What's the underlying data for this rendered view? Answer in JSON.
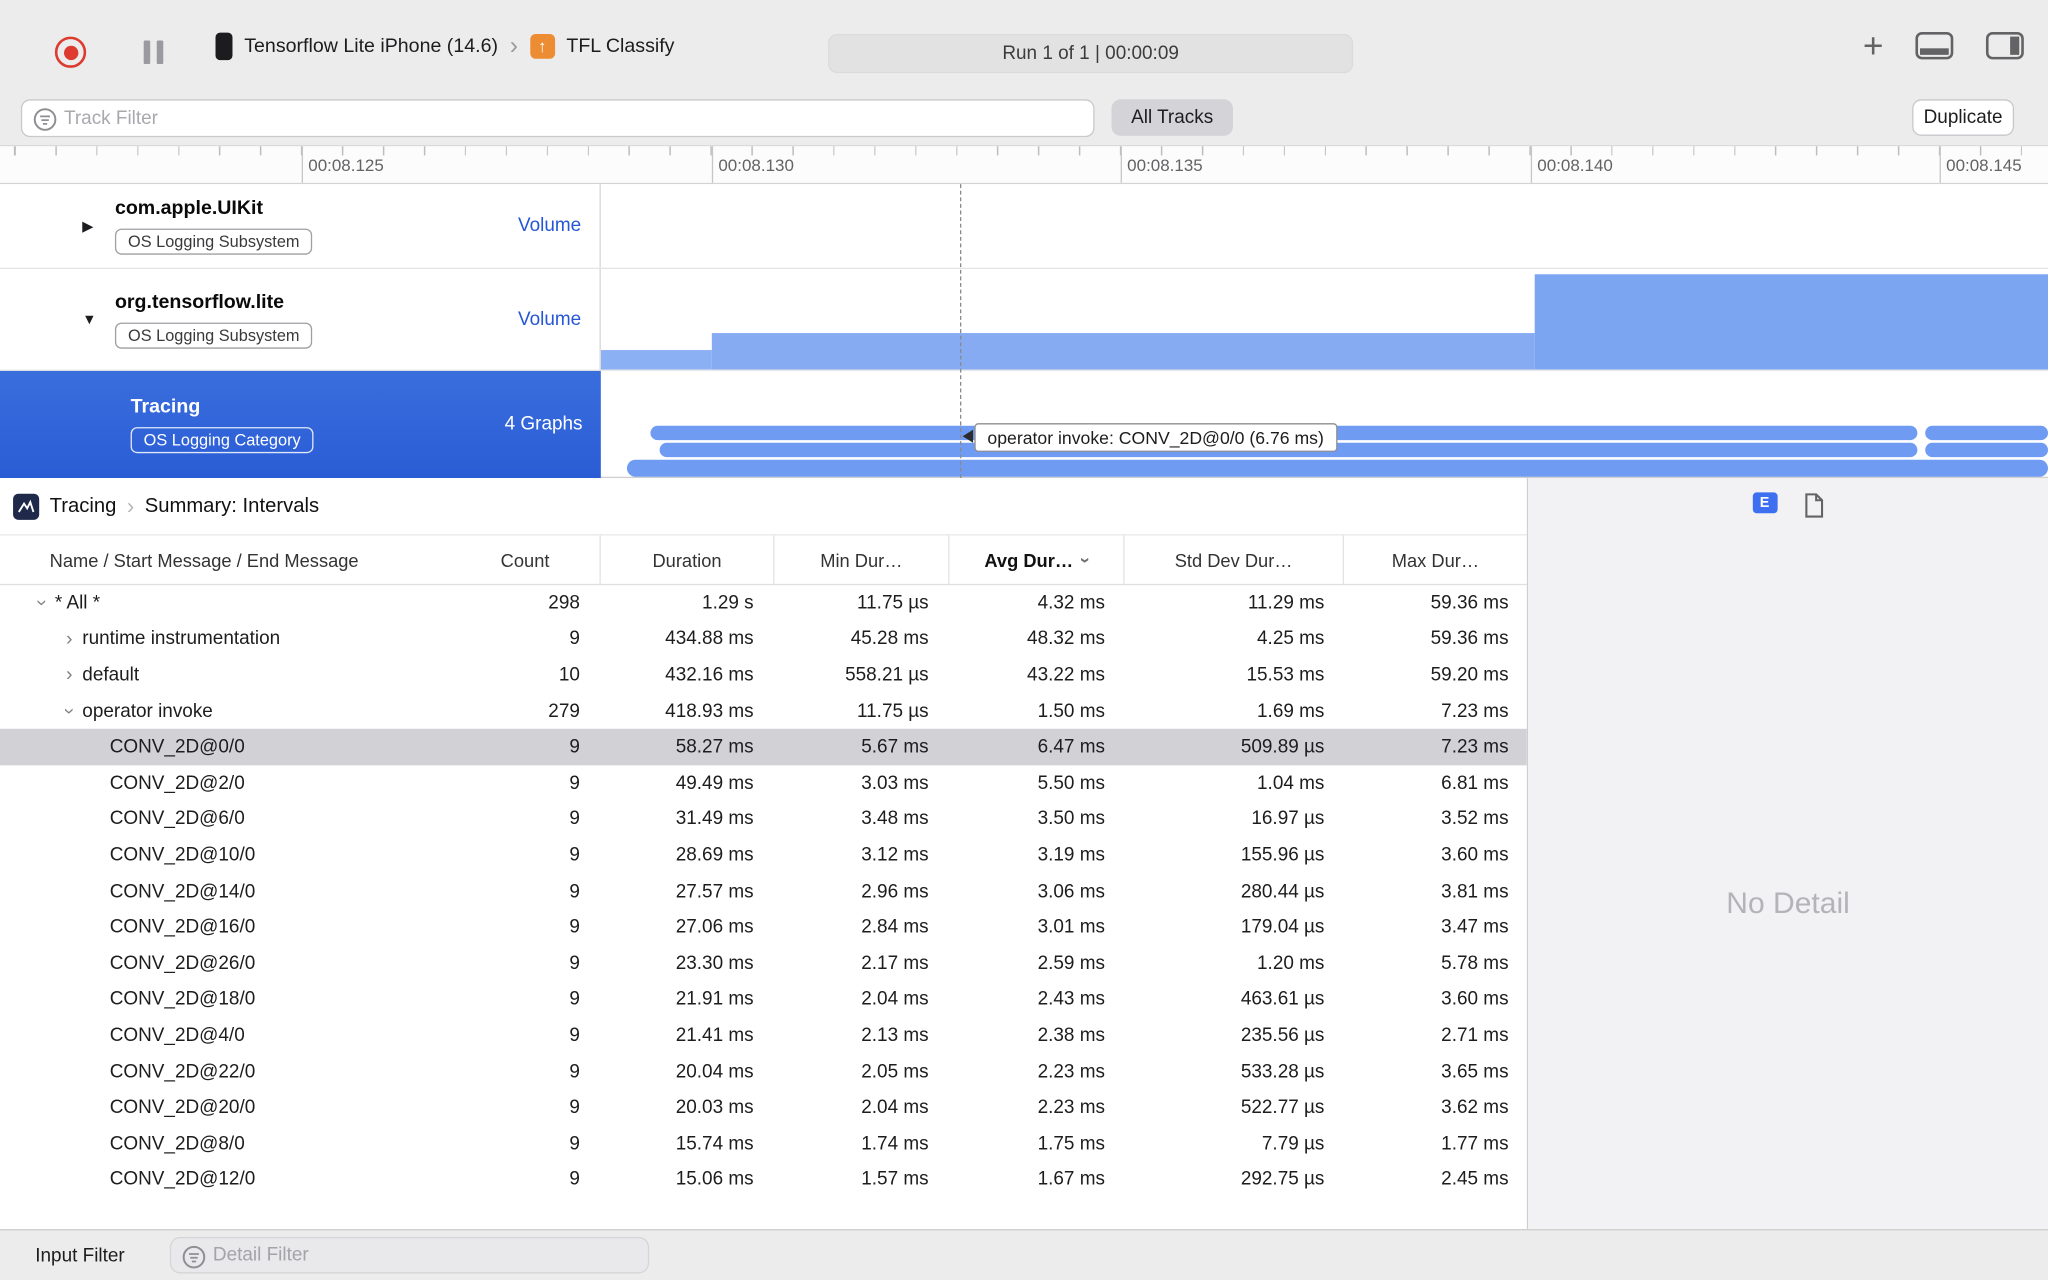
{
  "toolbar": {
    "device_label": "Tensorflow Lite iPhone (14.6)",
    "app_label": "TFL Classify",
    "run_status": "Run 1 of 1  |  00:00:09"
  },
  "filter_bar": {
    "track_filter_placeholder": "Track Filter",
    "all_tracks_label": "All Tracks",
    "duplicate_label": "Duplicate"
  },
  "ruler": {
    "ticks": [
      "00:08.125",
      "00:08.130",
      "00:08.135",
      "00:08.140",
      "00:08.145"
    ]
  },
  "tracks": [
    {
      "title": "com.apple.UIKit",
      "badge": "OS Logging Subsystem",
      "meta": "Volume",
      "state": "collapsed"
    },
    {
      "title": "org.tensorflow.lite",
      "badge": "OS Logging Subsystem",
      "meta": "Volume",
      "state": "expanded"
    },
    {
      "title": "Tracing",
      "badge": "OS Logging Category",
      "meta": "4 Graphs",
      "state": "selected"
    }
  ],
  "tracing_tooltip": "operator invoke: CONV_2D@0/0 (6.76 ms)",
  "icons": {
    "plus": "+",
    "chevron": "›",
    "disclosure_collapsed": "▶",
    "disclosure_expanded": "▼",
    "app_arrow": "↑",
    "detail_e": "E"
  },
  "detail": {
    "breadcrumb": {
      "root": "Tracing",
      "page": "Summary: Intervals"
    },
    "no_detail": "No Detail",
    "table": {
      "columns": [
        "Name / Start Message / End Message",
        "Count",
        "Duration",
        "Min Dur…",
        "Avg Dur…",
        "Std Dev Dur…",
        "Max Dur…"
      ],
      "sort_column": "Avg Dur…",
      "rows": [
        {
          "level": 0,
          "expand": "open",
          "name": "* All *",
          "count": "298",
          "duration": "1.29 s",
          "min": "11.75 µs",
          "avg": "4.32 ms",
          "std": "11.29 ms",
          "max": "59.36 ms"
        },
        {
          "level": 1,
          "expand": "closed",
          "name": "runtime instrumentation",
          "count": "9",
          "duration": "434.88 ms",
          "min": "45.28 ms",
          "avg": "48.32 ms",
          "std": "4.25 ms",
          "max": "59.36 ms"
        },
        {
          "level": 1,
          "expand": "closed",
          "name": "default",
          "count": "10",
          "duration": "432.16 ms",
          "min": "558.21 µs",
          "avg": "43.22 ms",
          "std": "15.53 ms",
          "max": "59.20 ms"
        },
        {
          "level": 1,
          "expand": "open",
          "name": "operator invoke",
          "count": "279",
          "duration": "418.93 ms",
          "min": "11.75 µs",
          "avg": "1.50 ms",
          "std": "1.69 ms",
          "max": "7.23 ms"
        },
        {
          "level": 2,
          "selected": true,
          "name": "CONV_2D@0/0",
          "count": "9",
          "duration": "58.27 ms",
          "min": "5.67 ms",
          "avg": "6.47 ms",
          "std": "509.89 µs",
          "max": "7.23 ms"
        },
        {
          "level": 2,
          "name": "CONV_2D@2/0",
          "count": "9",
          "duration": "49.49 ms",
          "min": "3.03 ms",
          "avg": "5.50 ms",
          "std": "1.04 ms",
          "max": "6.81 ms"
        },
        {
          "level": 2,
          "name": "CONV_2D@6/0",
          "count": "9",
          "duration": "31.49 ms",
          "min": "3.48 ms",
          "avg": "3.50 ms",
          "std": "16.97 µs",
          "max": "3.52 ms"
        },
        {
          "level": 2,
          "name": "CONV_2D@10/0",
          "count": "9",
          "duration": "28.69 ms",
          "min": "3.12 ms",
          "avg": "3.19 ms",
          "std": "155.96 µs",
          "max": "3.60 ms"
        },
        {
          "level": 2,
          "name": "CONV_2D@14/0",
          "count": "9",
          "duration": "27.57 ms",
          "min": "2.96 ms",
          "avg": "3.06 ms",
          "std": "280.44 µs",
          "max": "3.81 ms"
        },
        {
          "level": 2,
          "name": "CONV_2D@16/0",
          "count": "9",
          "duration": "27.06 ms",
          "min": "2.84 ms",
          "avg": "3.01 ms",
          "std": "179.04 µs",
          "max": "3.47 ms"
        },
        {
          "level": 2,
          "name": "CONV_2D@26/0",
          "count": "9",
          "duration": "23.30 ms",
          "min": "2.17 ms",
          "avg": "2.59 ms",
          "std": "1.20 ms",
          "max": "5.78 ms"
        },
        {
          "level": 2,
          "name": "CONV_2D@18/0",
          "count": "9",
          "duration": "21.91 ms",
          "min": "2.04 ms",
          "avg": "2.43 ms",
          "std": "463.61 µs",
          "max": "3.60 ms"
        },
        {
          "level": 2,
          "name": "CONV_2D@4/0",
          "count": "9",
          "duration": "21.41 ms",
          "min": "2.13 ms",
          "avg": "2.38 ms",
          "std": "235.56 µs",
          "max": "2.71 ms"
        },
        {
          "level": 2,
          "name": "CONV_2D@22/0",
          "count": "9",
          "duration": "20.04 ms",
          "min": "2.05 ms",
          "avg": "2.23 ms",
          "std": "533.28 µs",
          "max": "3.65 ms"
        },
        {
          "level": 2,
          "name": "CONV_2D@20/0",
          "count": "9",
          "duration": "20.03 ms",
          "min": "2.04 ms",
          "avg": "2.23 ms",
          "std": "522.77 µs",
          "max": "3.62 ms"
        },
        {
          "level": 2,
          "name": "CONV_2D@8/0",
          "count": "9",
          "duration": "15.74 ms",
          "min": "1.74 ms",
          "avg": "1.75 ms",
          "std": "7.79 µs",
          "max": "1.77 ms"
        },
        {
          "level": 2,
          "name": "CONV_2D@12/0",
          "count": "9",
          "duration": "15.06 ms",
          "min": "1.57 ms",
          "avg": "1.67 ms",
          "std": "292.75 µs",
          "max": "2.45 ms"
        }
      ]
    }
  },
  "bottom_bar": {
    "input_filter_label": "Input Filter",
    "detail_filter_placeholder": "Detail Filter"
  }
}
